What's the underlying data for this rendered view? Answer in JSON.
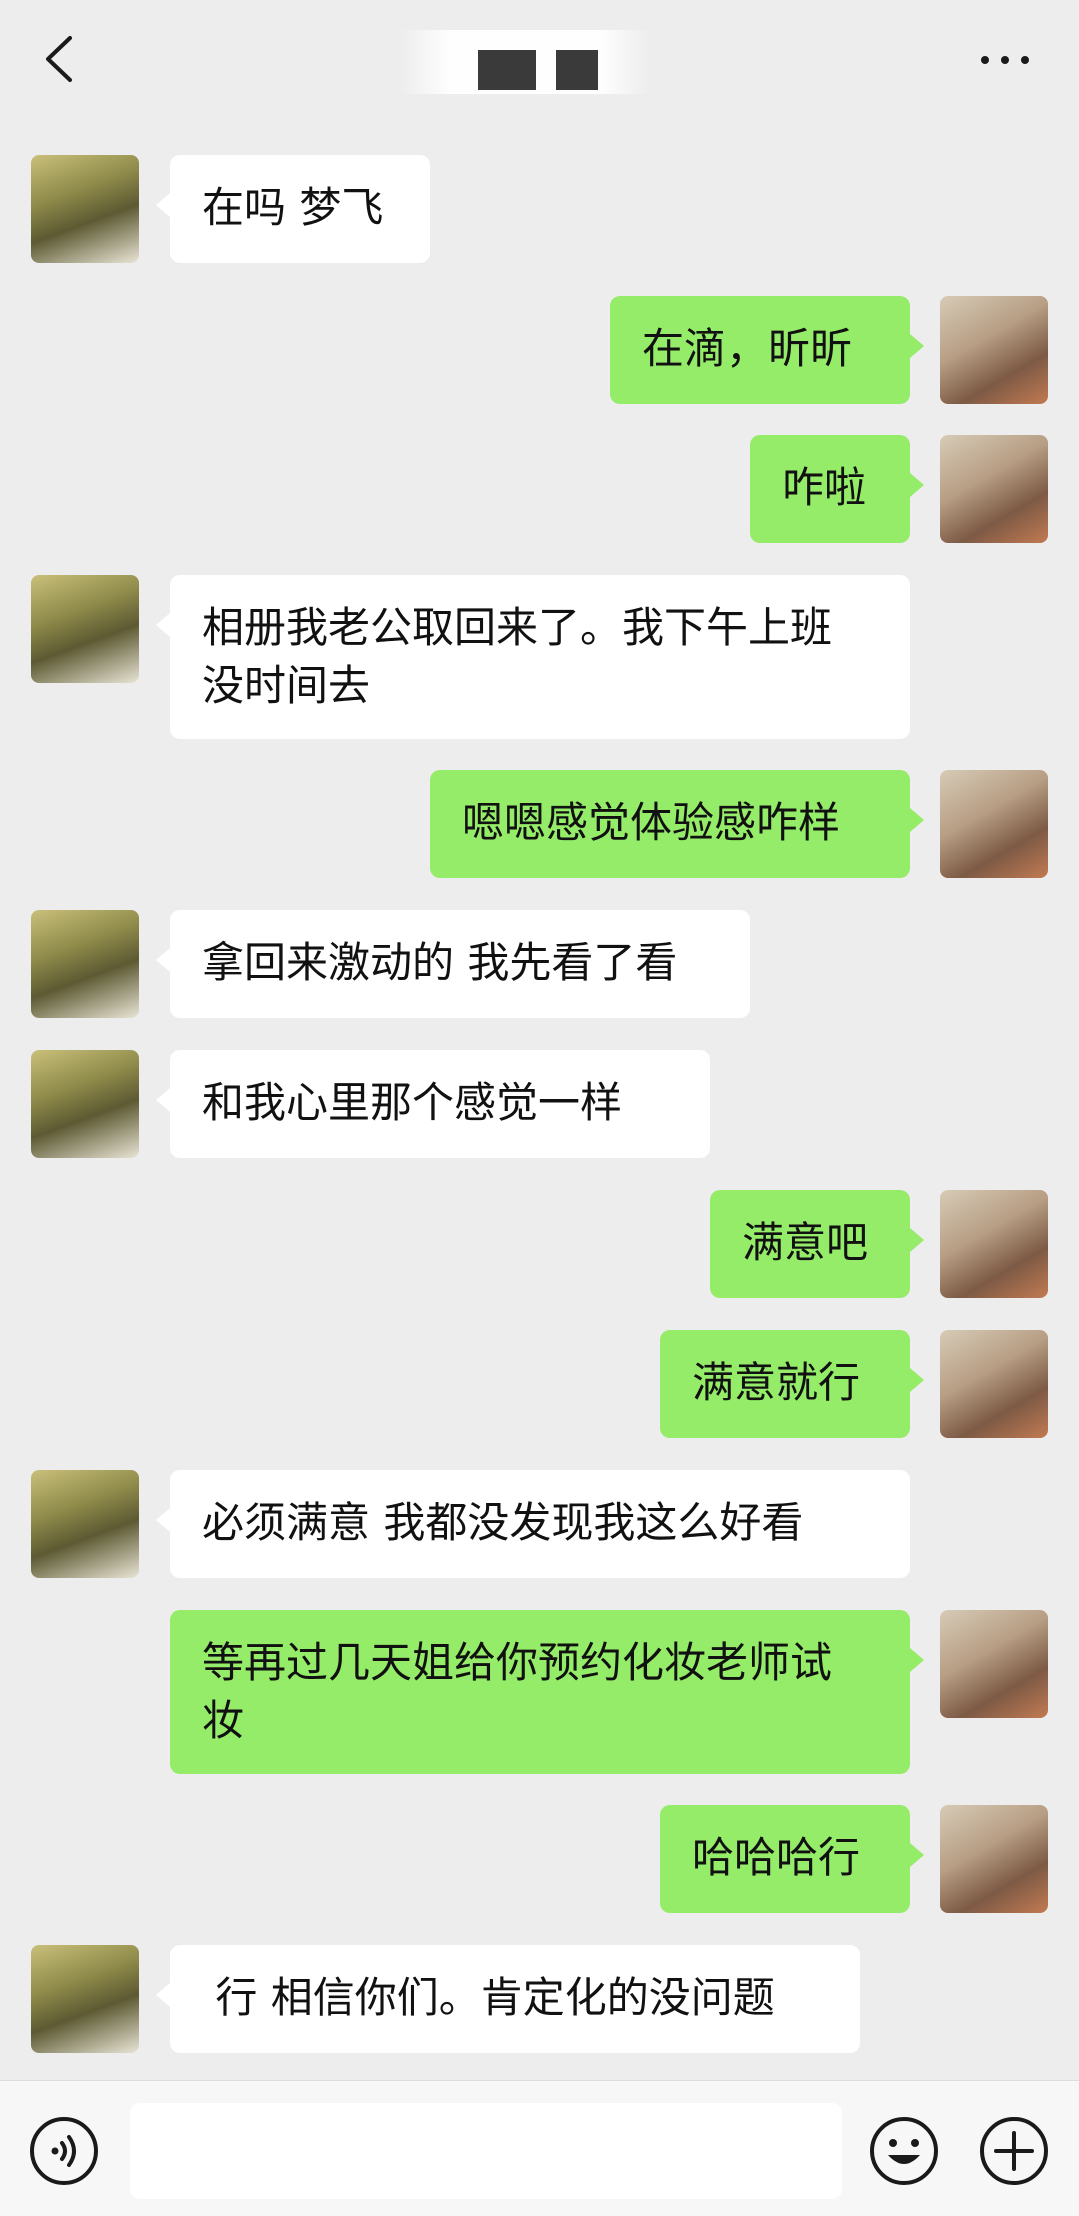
{
  "header": {
    "title": "",
    "back_icon": "chevron-left-icon",
    "more_icon": "more-dots-icon"
  },
  "colors": {
    "background": "#ededed",
    "incoming_bubble": "#ffffff",
    "outgoing_bubble": "#95ec69",
    "text": "#111111"
  },
  "messages": [
    {
      "side": "in",
      "text": "在吗 梦飞"
    },
    {
      "side": "out",
      "text": "在滴，昕昕"
    },
    {
      "side": "out",
      "text": "咋啦"
    },
    {
      "side": "in",
      "text": "相册我老公取回来了。我下午上班\n没时间去"
    },
    {
      "side": "out",
      "text": "嗯嗯感觉体验感咋样"
    },
    {
      "side": "in",
      "text": "拿回来激动的 我先看了看"
    },
    {
      "side": "in",
      "text": "和我心里那个感觉一样"
    },
    {
      "side": "out",
      "text": "满意吧"
    },
    {
      "side": "out",
      "text": "满意就行"
    },
    {
      "side": "in",
      "text": "必须满意 我都没发现我这么好看"
    },
    {
      "side": "out",
      "text": "等再过几天姐给你预约化妆老师试\n妆"
    },
    {
      "side": "out",
      "text": "哈哈哈行"
    },
    {
      "side": "in",
      "text": " 行 相信你们。肯定化的没问题"
    }
  ],
  "input_bar": {
    "voice_icon": "voice-icon",
    "message_value": "",
    "emoji_icon": "emoji-icon",
    "plus_icon": "plus-icon"
  }
}
